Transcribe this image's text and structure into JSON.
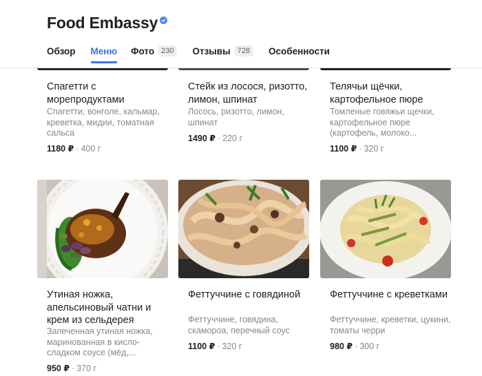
{
  "header": {
    "title": "Food Embassy",
    "tabs": [
      {
        "label": "Обзор"
      },
      {
        "label": "Меню"
      },
      {
        "label": "Фото",
        "count": "230"
      },
      {
        "label": "Отзывы",
        "count": "728"
      },
      {
        "label": "Особенности"
      }
    ]
  },
  "menu": {
    "items": [
      {
        "name": "Спагетти с морепродуктами",
        "desc": "Спагетти, вонголе, кальмар, креветка, мидии, томатная сальса",
        "price": "1180 ₽",
        "weight": "400 г"
      },
      {
        "name": "Стейк из лосося, ризотто, лимон, шпинат",
        "desc": "Лосось, ризотто, лимон, шпинат",
        "price": "1490 ₽",
        "weight": "220 г"
      },
      {
        "name": "Телячьи щёчки, картофельное пюре",
        "desc": "Томленые говяжьи щечки, картофельное пюре (картофель, молоко...",
        "price": "1100 ₽",
        "weight": "320 г"
      },
      {
        "name": "Утиная ножка, апельсиновый чатни и крем из сельдерея",
        "desc": "Запеченная утиная ножка, маринованная в кисло-сладком соусе (мёд,...",
        "price": "950 ₽",
        "weight": "370 г"
      },
      {
        "name": "Феттуччине с говядиной",
        "desc": "Феттуччине, говядина, скамороа, перечный соус",
        "price": "1100 ₽",
        "weight": "320 г"
      },
      {
        "name": "Феттуччине с креветками",
        "desc": "Феттуччине, креветки, цукини, томаты черри",
        "price": "980 ₽",
        "weight": "300 г"
      }
    ],
    "separator": "·"
  }
}
